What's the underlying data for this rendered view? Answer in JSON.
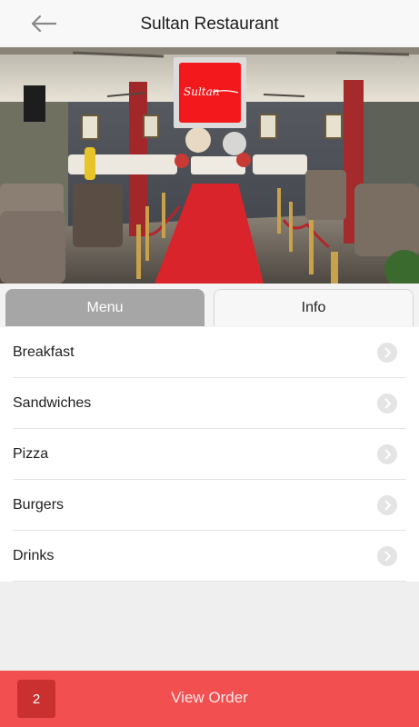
{
  "header": {
    "title": "Sultan Restaurant",
    "back_icon": "arrow-left-icon"
  },
  "hero": {
    "logo_text": "Sultan",
    "logo_color": "#f2181b"
  },
  "tabs": [
    {
      "label": "Menu",
      "active": true
    },
    {
      "label": "Info",
      "active": false
    }
  ],
  "menu": {
    "items": [
      {
        "label": "Breakfast"
      },
      {
        "label": "Sandwiches"
      },
      {
        "label": "Pizza"
      },
      {
        "label": "Burgers"
      },
      {
        "label": "Drinks"
      }
    ],
    "item_icon": "chevron-right-icon"
  },
  "order_bar": {
    "count": "2",
    "label": "View Order",
    "color": "#f24f51"
  }
}
